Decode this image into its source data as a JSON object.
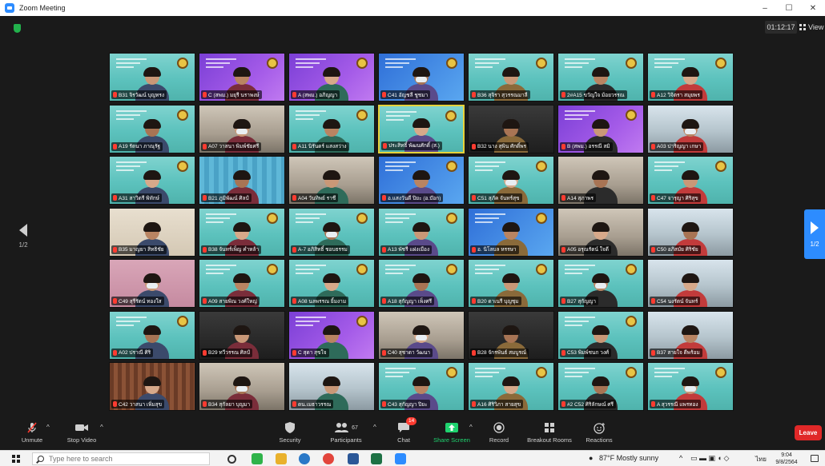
{
  "window": {
    "title": "Zoom Meeting",
    "controls": [
      "–",
      "☐",
      "✕"
    ]
  },
  "meeting": {
    "timer": "01:12:17",
    "view_label": "View"
  },
  "pages": {
    "left": "1/2",
    "right": "1/2"
  },
  "tiles": [
    {
      "name": "B31 จิรวัฒน์ บุญทรง",
      "bg": "teal"
    },
    {
      "name": "C (สพม.) มยุรี นราพงษ์",
      "bg": "purple"
    },
    {
      "name": "A (สพม.) อภิญญา",
      "bg": "purple"
    },
    {
      "name": "C41 อัญชลี ชูชมา",
      "bg": "blue"
    },
    {
      "name": "B36 สุจิรา สุวรรณมาลี",
      "bg": "teal"
    },
    {
      "name": "2#A15 ขวัญใจ ม้อยวรรณ",
      "bg": "teal"
    },
    {
      "name": "A12 วิจิตรา สมุยพร",
      "bg": "teal"
    },
    {
      "name": "A19 รัตนา ภาณุรัฐ",
      "bg": "teal"
    },
    {
      "name": "A07 วาสนา พิมพ์ชัยศรี",
      "bg": "room"
    },
    {
      "name": "A11 นิรันดร์ แสงสว่าง",
      "bg": "teal"
    },
    {
      "name": "ประสิทธิ์ พัฒนศักดิ์ (ส.)",
      "bg": "teal",
      "active": true
    },
    {
      "name": "B32 นาง สุพิน ศักดิ์พร",
      "bg": "dark"
    },
    {
      "name": "B (สพม.) อรรณี สมิ",
      "bg": "purple"
    },
    {
      "name": "A03 ปาริญญา เกษา",
      "bg": "window-bg"
    },
    {
      "name": "A31 สาวิตรี พิทักษ์",
      "bg": "teal"
    },
    {
      "name": "B21 ภูมิพัฒน์ ศิลป์",
      "bg": "striped"
    },
    {
      "name": "A04 วันทิพย์ ราชี",
      "bg": "room"
    },
    {
      "name": "อ.แสงวันดี ปิยะ (อ.บ๊อก)",
      "bg": "blue"
    },
    {
      "name": "C51 สุภัค จันทร์สุข",
      "bg": "teal"
    },
    {
      "name": "A14 สุภาพร",
      "bg": "room"
    },
    {
      "name": "C47 จารุญา ศิริสุข",
      "bg": "teal"
    },
    {
      "name": "B35 มาญยา สิทธิชัย",
      "bg": "beige"
    },
    {
      "name": "B38 จันทร์เพ็ญ คำหล้า",
      "bg": "teal"
    },
    {
      "name": "A-7 อภิสิทธิ์ ชอบธรรม",
      "bg": "teal"
    },
    {
      "name": "A13 พัชรี แฝงเมือง",
      "bg": "teal"
    },
    {
      "name": "อ. นิโลบล หรรษา",
      "bg": "blue"
    },
    {
      "name": "A05 อรุณรัตน์ ใจดี",
      "bg": "room"
    },
    {
      "name": "C50 อภิสมัย ศิริชัย",
      "bg": "window-bg"
    },
    {
      "name": "C49 สุรีรัตน์ ทองใส",
      "bg": "pink"
    },
    {
      "name": "A09 สายพิณ วงศ์ใหญ่",
      "bg": "teal"
    },
    {
      "name": "A08 นลพรรณ ยิ้มงาม",
      "bg": "teal"
    },
    {
      "name": "A18 สุกัญญา เพ็งศรี",
      "bg": "teal"
    },
    {
      "name": "B20 ดาเนรี บุญชุม",
      "bg": "teal"
    },
    {
      "name": "B27 สุกัญญา",
      "bg": "teal"
    },
    {
      "name": "C54 นงรัตน์ จันทร์",
      "bg": "window-bg"
    },
    {
      "name": "A02 ปราณี ศิริ",
      "bg": "teal"
    },
    {
      "name": "B29 ทวีวรรณ ศิลป์",
      "bg": "dark"
    },
    {
      "name": "C สุดา สุขใจ",
      "bg": "purple"
    },
    {
      "name": "C40 สุชาดา วัฒนา",
      "bg": "room"
    },
    {
      "name": "B28 จักรพันธ์ สมบูรณ์",
      "bg": "dark"
    },
    {
      "name": "C53 พิมพ์ชนก วงศ์",
      "bg": "teal"
    },
    {
      "name": "B37 สายใจ ดีพร้อม",
      "bg": "window-bg"
    },
    {
      "name": "C42 วาสนา เพิ่มสุข",
      "bg": "curtain"
    },
    {
      "name": "B34 สุกัลยา บุญมา",
      "bg": "room"
    },
    {
      "name": "ดน.เมธาวรรณ",
      "bg": "window-bg"
    },
    {
      "name": "C43 สุกัญญา ปิยะ",
      "bg": "teal"
    },
    {
      "name": "A16 ศิริวิภา สายสุข",
      "bg": "teal"
    },
    {
      "name": "#2 C52 ศิริลักษณ์ ศรี",
      "bg": "teal"
    },
    {
      "name": "A สุวรรณี แพรทอง",
      "bg": "teal"
    }
  ],
  "toolbar": {
    "unmute": "Unmute",
    "stop_video": "Stop Video",
    "security": "Security",
    "participants": "Participants",
    "participants_count": "67",
    "chat": "Chat",
    "chat_badge": "14",
    "share_screen": "Share Screen",
    "record": "Record",
    "breakout_rooms": "Breakout Rooms",
    "reactions": "Reactions",
    "leave": "Leave"
  },
  "taskbar": {
    "search_placeholder": "Type here to search",
    "weather": "87°F  Mostly sunny",
    "lang": "ไทย",
    "time": "9:04",
    "date": "9/8/2564"
  },
  "colors": {
    "share_green": "#1fd36f",
    "leave_red": "#e02828",
    "zoom_blue": "#2d8cff"
  }
}
